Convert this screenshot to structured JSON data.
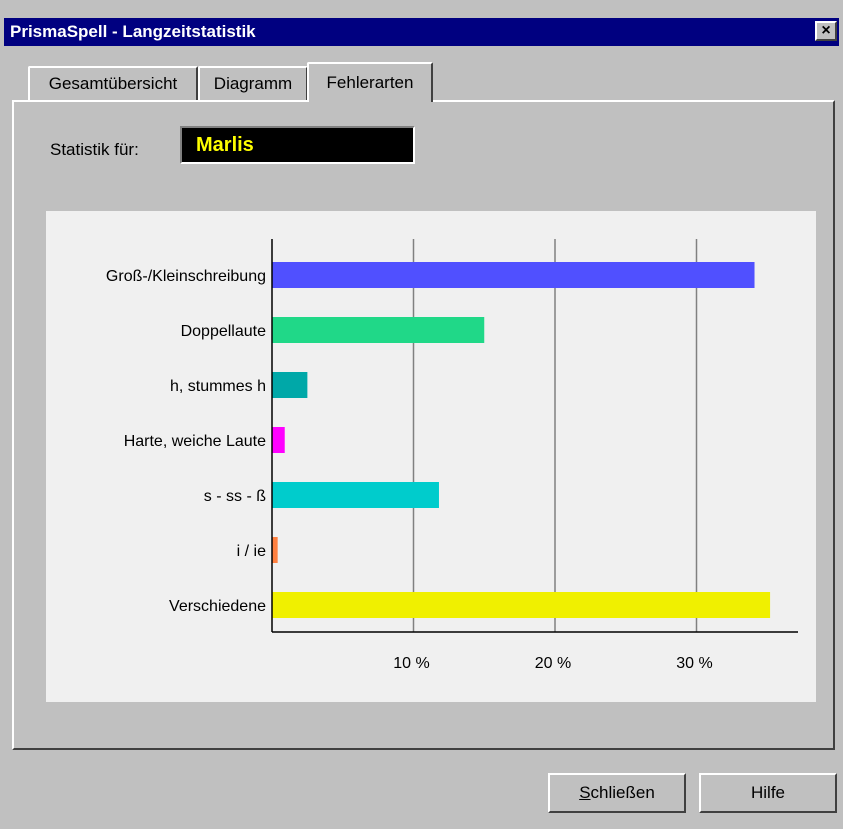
{
  "window": {
    "title": "PrismaSpell - Langzeitstatistik",
    "close_label": "×"
  },
  "tabs": [
    {
      "label": "Gesamtübersicht",
      "active": false
    },
    {
      "label": "Diagramm",
      "active": false
    },
    {
      "label": "Fehlerarten",
      "active": true
    }
  ],
  "statistik": {
    "label": "Statistik für:",
    "value": "Marlis",
    "value_color": "#ffff00"
  },
  "chart_data": {
    "type": "bar",
    "orientation": "horizontal",
    "categories": [
      "Groß-/Kleinschreibung",
      "Doppellaute",
      "h, stummes h",
      "Harte, weiche Laute",
      "s - ss - ß",
      "i / ie",
      "Verschiedene"
    ],
    "values": [
      34.1,
      15.0,
      2.5,
      0.9,
      11.8,
      0.4,
      35.2
    ],
    "colors": [
      "#5050ff",
      "#20d888",
      "#00a8a8",
      "#ff00ff",
      "#00cccc",
      "#ff8040",
      "#f0f000"
    ],
    "x_ticks": [
      "10 %",
      "20 %",
      "30 %"
    ],
    "x_tick_values": [
      10,
      20,
      30
    ],
    "xlim": [
      0,
      37
    ],
    "grid": "vertical",
    "legend": "none"
  },
  "buttons": {
    "close_access": "S",
    "close_rest": "chließen",
    "help_label": "Hilfe"
  }
}
